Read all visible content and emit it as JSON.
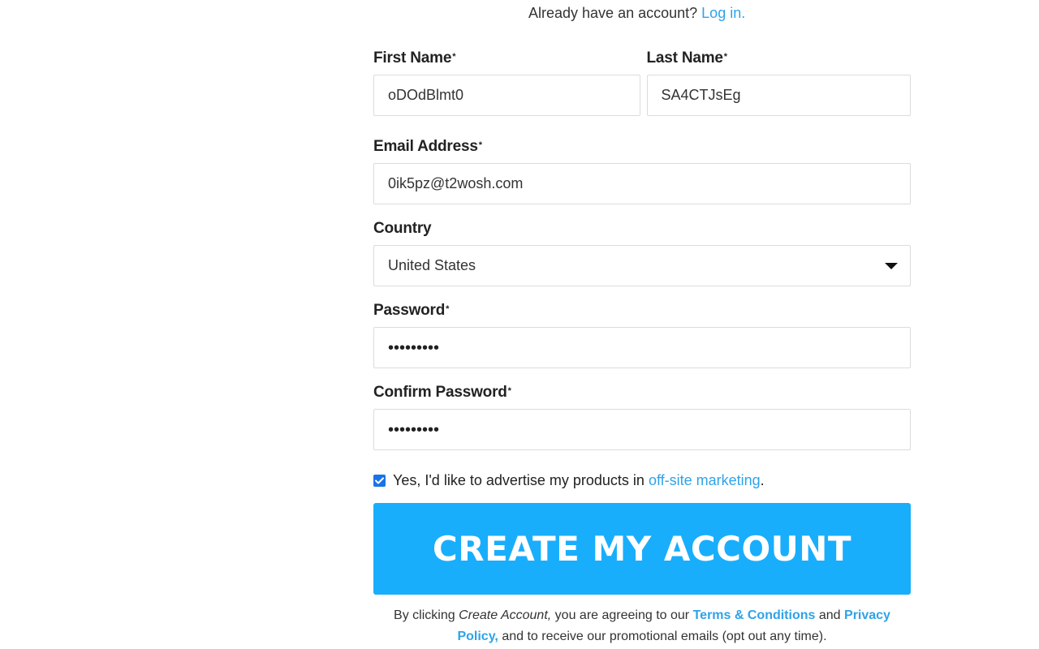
{
  "login_prompt": {
    "text": "Already have an account?",
    "link_label": "Log in."
  },
  "fields": {
    "first_name": {
      "label": "First Name",
      "required_mark": "*",
      "value": "oDOdBlmt0"
    },
    "last_name": {
      "label": "Last Name",
      "required_mark": "*",
      "value": "SA4CTJsEg"
    },
    "email": {
      "label": "Email Address",
      "required_mark": "*",
      "value": "0ik5pz@t2wosh.com"
    },
    "country": {
      "label": "Country",
      "value": "United States"
    },
    "password": {
      "label": "Password",
      "required_mark": "*",
      "masked_value": "•••••••••"
    },
    "confirm_password": {
      "label": "Confirm Password",
      "required_mark": "*",
      "masked_value": "•••••••••"
    }
  },
  "marketing_opt_in": {
    "checked": true,
    "text_before": "Yes, I'd like to advertise my products in",
    "link_label": "off-site marketing",
    "text_after": "."
  },
  "submit": {
    "label": "CREATE MY ACCOUNT"
  },
  "terms": {
    "prefix": "By clicking",
    "action_name": "Create Account,",
    "middle": "you are agreeing to our",
    "terms_link": "Terms & Conditions",
    "and": "and",
    "privacy_link": "Privacy Policy,",
    "suffix": "and to receive our promotional emails (opt out any time)."
  },
  "colors": {
    "accent": "#19aefc",
    "link": "#2ea3e8",
    "checkbox": "#1a73e8"
  }
}
